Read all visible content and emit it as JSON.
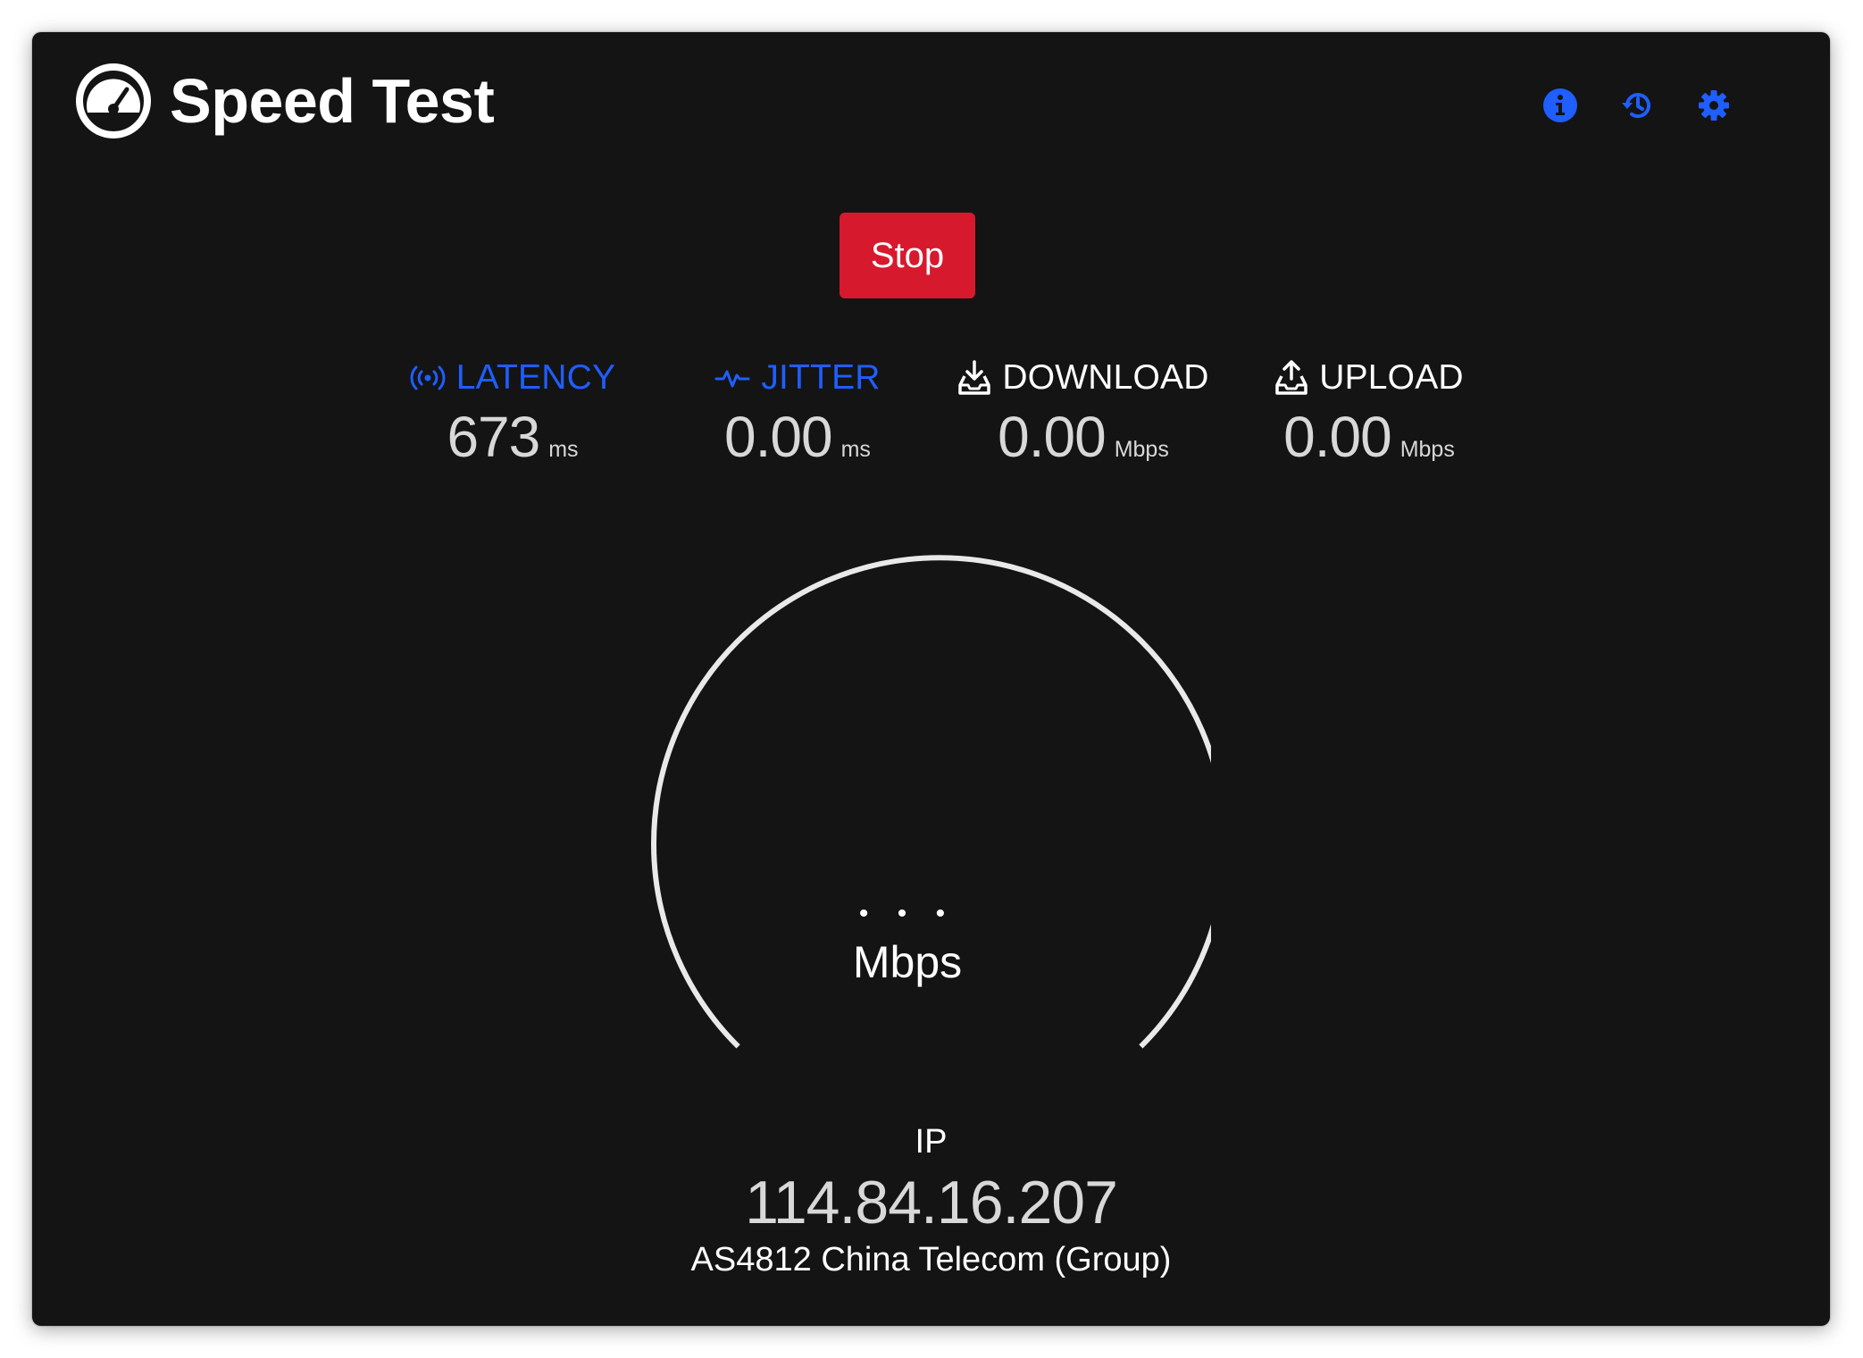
{
  "app": {
    "title": "Speed Test"
  },
  "header": {
    "actions": [
      {
        "name": "info-icon",
        "color": "#1f5eff"
      },
      {
        "name": "history-icon",
        "color": "#1f5eff"
      },
      {
        "name": "settings-gear-icon",
        "color": "#1f5eff"
      }
    ]
  },
  "controls": {
    "stop_label": "Stop",
    "stop_color": "#d7192e"
  },
  "metrics": {
    "latency": {
      "label": "LATENCY",
      "value": "673",
      "unit": "ms",
      "icon": "signal-broadcast-icon",
      "accent": "#1f5eff"
    },
    "jitter": {
      "label": "JITTER",
      "value": "0.00",
      "unit": "ms",
      "icon": "pulse-icon",
      "accent": "#1f5eff"
    },
    "download": {
      "label": "DOWNLOAD",
      "value": "0.00",
      "unit": "Mbps",
      "icon": "download-tray-icon",
      "accent": "#ffffff"
    },
    "upload": {
      "label": "UPLOAD",
      "value": "0.00",
      "unit": "Mbps",
      "icon": "upload-tray-icon",
      "accent": "#ffffff"
    }
  },
  "gauge": {
    "value_placeholder": "• • •",
    "unit": "Mbps"
  },
  "connection": {
    "ip_label": "IP",
    "ip_address": "114.84.16.207",
    "isp": "AS4812 China Telecom (Group)"
  }
}
